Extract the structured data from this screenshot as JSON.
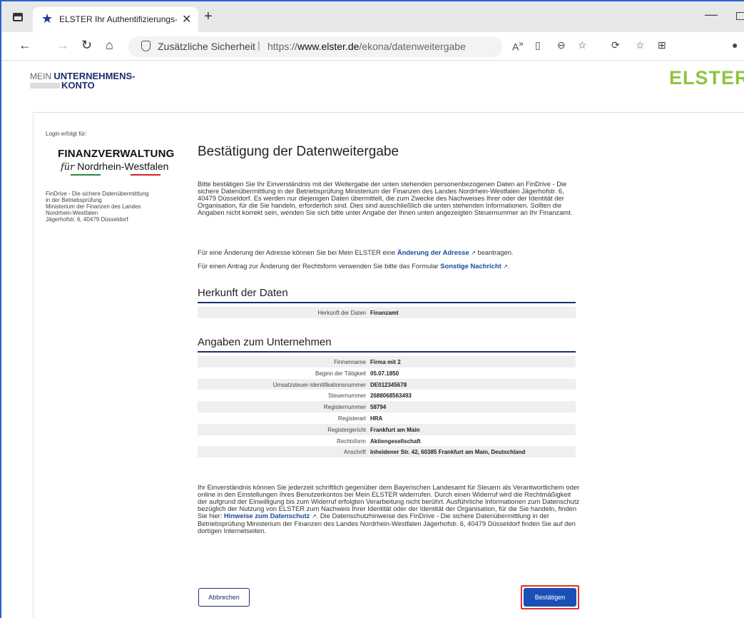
{
  "browser": {
    "tab_title": "ELSTER Ihr Authentifizierungs-Po",
    "tab_close": "✕",
    "new_tab": "+",
    "security_label": "Zusätzliche Sicherheit",
    "url_prefix": "https://",
    "url_domain": "www.elster.de",
    "url_path": "/ekona/datenweitergabe"
  },
  "header": {
    "mein": "MEIN",
    "unternehmens": "UNTERNEHMENS-",
    "konto": "KONTO",
    "elster": "ELSTER"
  },
  "sidebar": {
    "login_for": "Login erfolgt für:",
    "logo_line1": "FINANZVERWALTUNG",
    "logo_fuer": "für",
    "logo_line2": "Nordrhein-Westfalen",
    "info": "FinDrive - Die sichere Datenübermittlung\nin der Betriebsprüfung\nMinisterium der Finanzen des Landes\nNordrhein-Westfalen\nJägerhofstr. 6, 40479 Düsseldorf"
  },
  "main": {
    "title": "Bestätigung der Datenweitergabe",
    "intro": "Bitte bestätigen Sie Ihr Einverständnis mit der Weitergabe der unten stehenden personenbezogenen Daten an FinDrive - Die sichere Datenübermittlung in der Betriebsprüfung Ministerium der Finanzen des Landes Nordrhein-Westfalen Jägerhofstr. 6, 40479 Düsseldorf. Es werden nur diejenigen Daten übermittelt, die zum Zwecke des Nachweises Ihrer oder der Identität der Organisation, für die Sie handeln, erforderlich sind. Dies sind ausschließlich die unten stehenden Informationen. Sollten die Angaben nicht korrekt sein, wenden Sie sich bitte unter Angabe der Ihnen unten angezeigten Steuernummer an Ihr Finanzamt.",
    "address_text": "Für eine Änderung der Adresse können Sie bei Mein ELSTER eine ",
    "address_link": "Änderung der Adresse",
    "address_suffix": " beantragen.",
    "legal_text": "Für einen Antrag zur Änderung der Rechtsform verwenden Sie bitte das Formular ",
    "legal_link": "Sonstige Nachricht",
    "legal_suffix": ".",
    "origin_title": "Herkunft der Daten",
    "origin_rows": [
      {
        "k": "Herkunft der Daten",
        "v": "Finanzamt"
      }
    ],
    "company_title": "Angaben zum Unternehmen",
    "company_rows": [
      {
        "k": "Firmenname",
        "v": "Firma mit 2"
      },
      {
        "k": "Beginn der Tätigkeit",
        "v": "05.07.1850"
      },
      {
        "k": "Umsatzsteuer-Identifikationsnummer",
        "v": "DE012345678"
      },
      {
        "k": "Steuernummer",
        "v": "2688068563493"
      },
      {
        "k": "Registernummer",
        "v": "58794"
      },
      {
        "k": "Registerart",
        "v": "HRA"
      },
      {
        "k": "Registergericht",
        "v": "Frankfurt am Main"
      },
      {
        "k": "Rechtsform",
        "v": "Aktiengesellschaft"
      },
      {
        "k": "Anschrift",
        "v": "Inheidener Str. 42, 60385 Frankfurt am Main, Deutschland"
      }
    ],
    "consent_text": "Ihr Einverständnis können Sie jederzeit schriftlich gegenüber dem Bayerischen Landesamt für Steuern als Verantwortlichem oder online in den Einstellungen Ihres Benutzerkontos bei Mein ELSTER widerrufen. Durch einen Widerruf wird die Rechtmäßigkeit der aufgrund der Einwilligung bis zum Widerruf erfolgten Verarbeitung nicht berührt. Ausführliche Informationen zum Datenschutz bezüglich der Nutzung von ELSTER zum Nachweis Ihrer Identität oder der Identität der Organisation, für die Sie handeln, finden Sie hier: ",
    "consent_link": "Hinweise zum Datenschutz",
    "consent_suffix": ". Die Datenschutzhinweise des FinDrive - Die sichere Datenübermittlung in der Betriebsprüfung Ministerium der Finanzen des Landes Nordrhein-Westfalen Jägerhofstr. 6, 40479 Düsseldorf finden Sie auf den dortigen Internetseiten.",
    "cancel_label": "Abbrechen",
    "confirm_label": "Bestätigen"
  },
  "colors": {
    "brand_navy": "#1a2f6b",
    "elster_green": "#8dc63f",
    "link_blue": "#1a4a9a",
    "confirm_blue": "#1a4fb5",
    "highlight_red": "#e0322b"
  }
}
